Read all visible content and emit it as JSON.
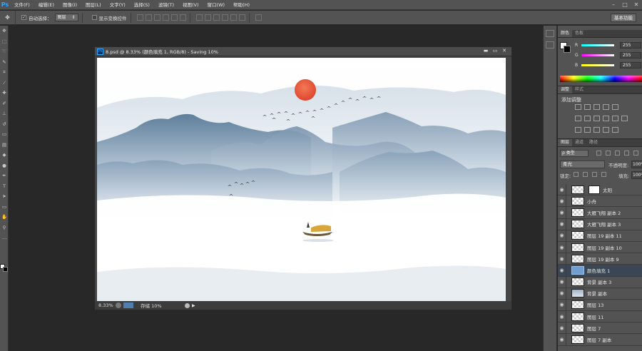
{
  "app": {
    "logo": "Ps",
    "menu": [
      "文件(F)",
      "编辑(E)",
      "图像(I)",
      "图层(L)",
      "文字(Y)",
      "选择(S)",
      "滤镜(T)",
      "视图(V)",
      "窗口(W)",
      "帮助(H)"
    ],
    "window_controls": [
      "–",
      "□",
      "✕"
    ]
  },
  "options_bar": {
    "auto_select_label": "自动选择：",
    "auto_select_value": "图层",
    "auto_select_checked": true,
    "show_transform_label": "显示变换控件",
    "show_transform_checked": false,
    "workspace": "基本功能"
  },
  "document": {
    "title": "8.psd @ 8.33% (颜色填充 1, RGB/8) - Saving 10%",
    "zoom": "8.33%",
    "status": "存储 10%",
    "controls": [
      "▬",
      "▭",
      "✕"
    ],
    "progress": 0.1
  },
  "color_panel": {
    "tabs": [
      "颜色",
      "色板"
    ],
    "foreground": "#ffffff",
    "background": "#000000",
    "channels": [
      {
        "label": "R",
        "value": "255",
        "gradient": "linear-gradient(to right, #00ffff, #ffffff)"
      },
      {
        "label": "G",
        "value": "255",
        "gradient": "linear-gradient(to right, #ff00ff, #ffffff)"
      },
      {
        "label": "B",
        "value": "255",
        "gradient": "linear-gradient(to right, #ffff00, #ffffff)"
      }
    ]
  },
  "adjustments_panel": {
    "tabs": [
      "调整",
      "样式"
    ],
    "title": "添加调整"
  },
  "layers_panel": {
    "tabs": [
      "图层",
      "通道",
      "路径"
    ],
    "filter": "ρ 类型",
    "blend_mode": "柔光",
    "opacity_label": "不透明度:",
    "opacity": "100%",
    "lock_label": "锁定:",
    "fill_label": "填充:",
    "fill": "100%",
    "layers": [
      {
        "name": "太阳",
        "kind": "masked",
        "selected": false
      },
      {
        "name": "小舟",
        "kind": "pixel",
        "selected": false
      },
      {
        "name": "大雁飞翔 副本 2",
        "kind": "pixel",
        "selected": false
      },
      {
        "name": "大雁飞翔 副本 3",
        "kind": "pixel",
        "selected": false
      },
      {
        "name": "图层 19 副本 11",
        "kind": "pixel",
        "selected": false
      },
      {
        "name": "图层 19 副本 10",
        "kind": "pixel",
        "selected": false
      },
      {
        "name": "图层 19 副本 9",
        "kind": "pixel",
        "selected": false
      },
      {
        "name": "颜色填充 1",
        "kind": "fill",
        "selected": true
      },
      {
        "name": "背景 副本 3",
        "kind": "pixel",
        "selected": false
      },
      {
        "name": "背景 副本",
        "kind": "image",
        "selected": false
      },
      {
        "name": "图层 13",
        "kind": "pixel",
        "selected": false
      },
      {
        "name": "图层 11",
        "kind": "pixel",
        "selected": false
      },
      {
        "name": "图层 7",
        "kind": "pixel",
        "selected": false
      },
      {
        "name": "图层 7 副本",
        "kind": "pixel",
        "selected": false
      }
    ]
  },
  "colors": {
    "ui_dark": "#535353",
    "workspace": "#282828",
    "accent": "#31a8ff",
    "sun": "#e8553a"
  }
}
